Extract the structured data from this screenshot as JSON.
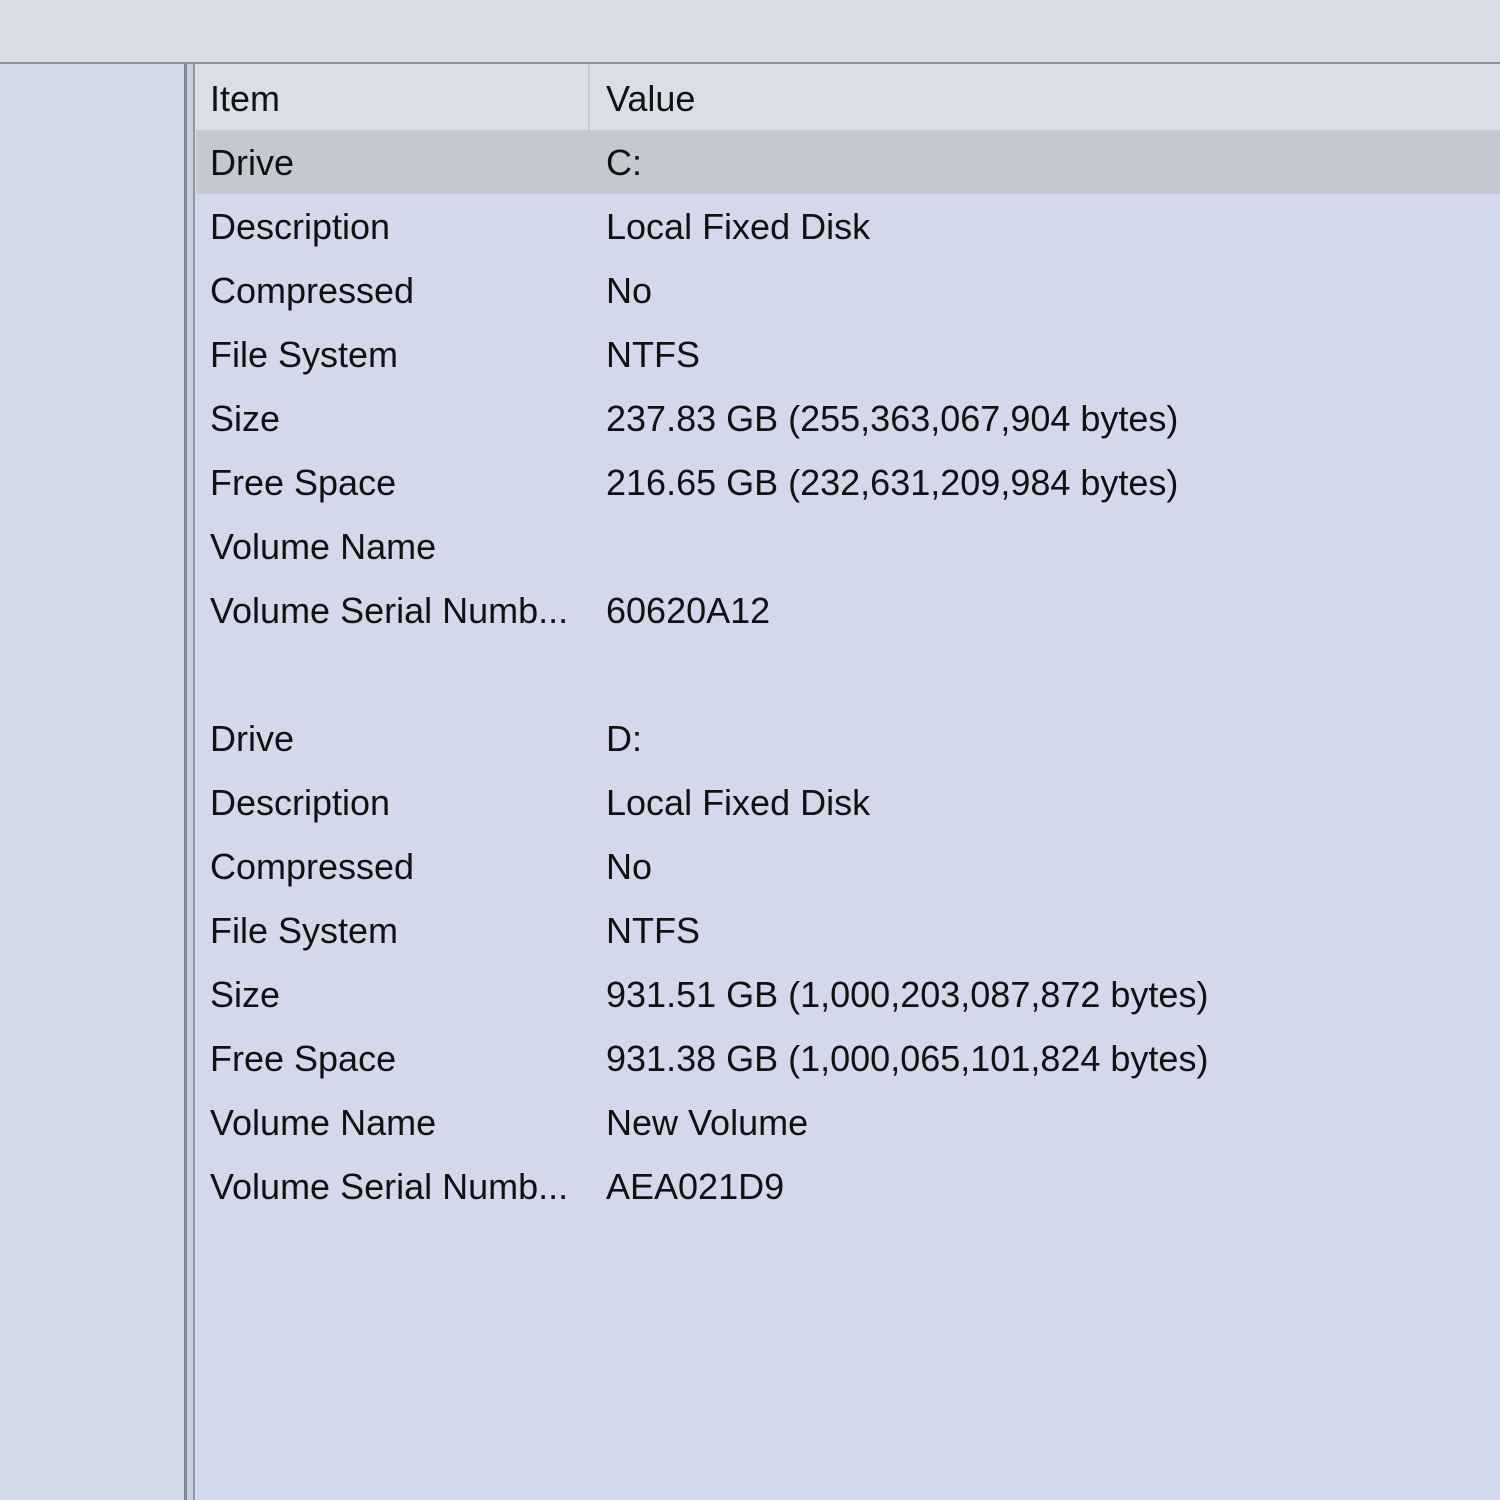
{
  "columns": {
    "item": "Item",
    "value": "Value"
  },
  "drives": [
    {
      "rows": [
        {
          "item": "Drive",
          "value": "C:"
        },
        {
          "item": "Description",
          "value": "Local Fixed Disk"
        },
        {
          "item": "Compressed",
          "value": "No"
        },
        {
          "item": "File System",
          "value": "NTFS"
        },
        {
          "item": "Size",
          "value": "237.83 GB (255,363,067,904 bytes)"
        },
        {
          "item": "Free Space",
          "value": "216.65 GB (232,631,209,984 bytes)"
        },
        {
          "item": "Volume Name",
          "value": ""
        },
        {
          "item": "Volume Serial Numb...",
          "value": "60620A12"
        }
      ]
    },
    {
      "rows": [
        {
          "item": "Drive",
          "value": "D:"
        },
        {
          "item": "Description",
          "value": "Local Fixed Disk"
        },
        {
          "item": "Compressed",
          "value": "No"
        },
        {
          "item": "File System",
          "value": "NTFS"
        },
        {
          "item": "Size",
          "value": "931.51 GB (1,000,203,087,872 bytes)"
        },
        {
          "item": "Free Space",
          "value": "931.38 GB (1,000,065,101,824 bytes)"
        },
        {
          "item": "Volume Name",
          "value": "New Volume"
        },
        {
          "item": "Volume Serial Numb...",
          "value": "AEA021D9"
        }
      ]
    }
  ],
  "selection": {
    "drive_index": 0,
    "row_index": 0
  }
}
